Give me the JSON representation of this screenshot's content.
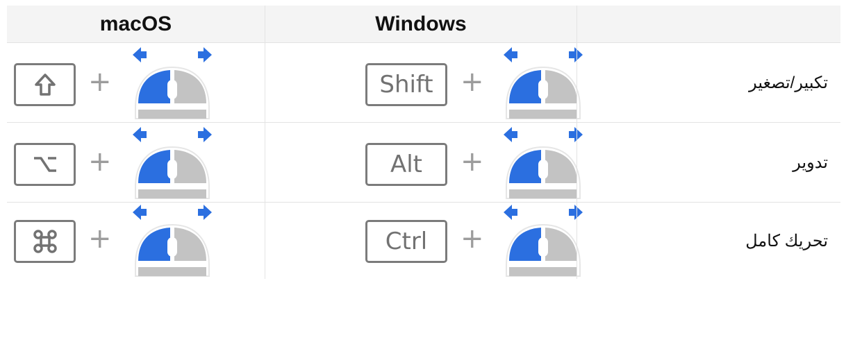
{
  "header": {
    "col1_label": "macOS",
    "col2_label": "Windows",
    "col3_label": ""
  },
  "plus_sign": "+",
  "rows": [
    {
      "action": "تكبير/تصغير",
      "mac_key_icon": "shift-arrow-icon",
      "windows_key_label": "Shift"
    },
    {
      "action": "تدوير",
      "mac_key_icon": "option-key-icon",
      "windows_key_label": "Alt"
    },
    {
      "action": "تحريك كامل",
      "mac_key_icon": "command-key-icon",
      "windows_key_label": "Ctrl"
    }
  ],
  "mouse_icon": "mouse-left-drag-icon",
  "colors": {
    "accent_blue": "#2b6fe0",
    "mouse_gray": "#c3c3c3",
    "key_border": "#7b7b7b",
    "header_bg": "#f4f4f4"
  }
}
